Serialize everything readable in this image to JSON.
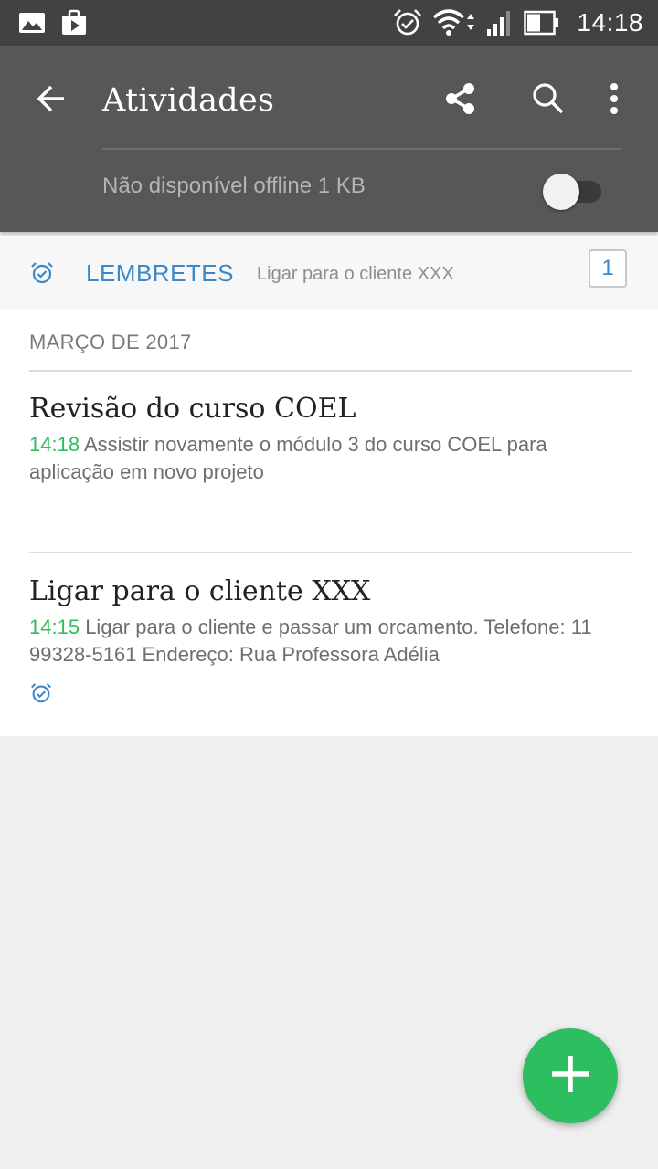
{
  "status_bar": {
    "time": "14:18",
    "icons": [
      "gallery-icon",
      "play-store-icon",
      "alarm-icon",
      "wifi-icon",
      "signal-icon",
      "battery-icon"
    ]
  },
  "app_bar": {
    "title": "Atividades",
    "back_icon": "arrow-left-icon",
    "actions": [
      "share-icon",
      "search-icon",
      "more-vert-icon"
    ],
    "offline_label": "Não disponível offline 1 KB",
    "offline_enabled": false
  },
  "reminders": {
    "label": "LEMBRETES",
    "preview": "Ligar para o cliente XXX",
    "count": "1",
    "icon": "alarm-check-icon"
  },
  "notes": {
    "section_header": "MARÇO DE 2017",
    "items": [
      {
        "title": "Revisão do curso COEL",
        "time": "14:18",
        "snippet": "Assistir novamente o módulo 3 do curso COEL para aplicação em novo projeto",
        "has_reminder": false
      },
      {
        "title": "Ligar para o cliente XXX",
        "time": "14:15",
        "snippet": "Ligar para o cliente e passar um orcamento. Telefone: 11 99328-5161 Endereço: Rua Professora Adélia",
        "has_reminder": true
      }
    ]
  },
  "fab": {
    "icon": "plus-icon"
  },
  "colors": {
    "status_bar": "#424242",
    "app_bar": "#575757",
    "accent_green": "#2dbe60",
    "accent_blue": "#3d87c9",
    "background": "#efefef"
  }
}
